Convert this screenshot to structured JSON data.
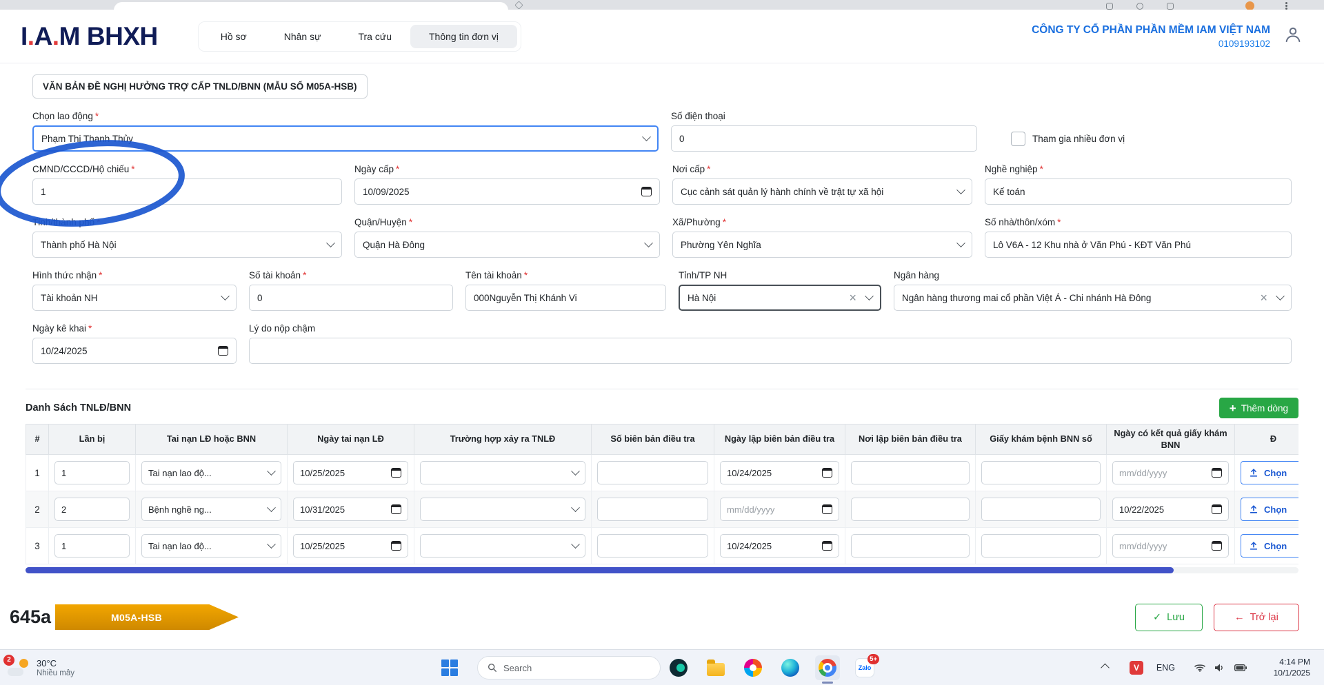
{
  "icons": {
    "check": "✓",
    "arrow_left": "←",
    "plus": "+",
    "clear": "×"
  },
  "header": {
    "logo": {
      "l1": "I",
      "d1": ".",
      "l2": "A",
      "d2": ".",
      "l3": "M",
      "suffix": "BHXH"
    },
    "nav": [
      {
        "label": "Hồ sơ"
      },
      {
        "label": "Nhân sự"
      },
      {
        "label": "Tra cứu"
      },
      {
        "label": "Thông tin đơn vị"
      }
    ],
    "company": "CÔNG TY CỔ PHẦN PHẦN MỀM IAM VIỆT NAM",
    "tax_code": "0109193102"
  },
  "ui": {
    "required_marker": "*"
  },
  "form": {
    "title": "VĂN BẢN ĐỀ NGHỊ HƯỞNG TRỢ CẤP TNLD/BNN (MẪU SỐ M05A-HSB)",
    "fields": {
      "chon_lao_dong": {
        "label": "Chọn lao động",
        "value": "Phạm Thị Thanh Thủy"
      },
      "so_dien_thoai": {
        "label": "Số điện thoại",
        "value": "0"
      },
      "tham_gia_nhieu_don_vi": {
        "label": "Tham gia nhiều đơn vị"
      },
      "cmnd": {
        "label": "CMND/CCCD/Hộ chiếu",
        "value": "1"
      },
      "ngay_cap": {
        "label": "Ngày cấp",
        "value": "10/09/2025"
      },
      "noi_cap": {
        "label": "Nơi cấp",
        "value": "Cục cảnh sát quản lý hành chính về trật tự xã hội"
      },
      "nghe_nghiep": {
        "label": "Nghề nghiệp",
        "value": "Kế toán"
      },
      "tinh_thanh_pho": {
        "label": "Tỉnh/thành phố",
        "value": "Thành phố Hà Nội"
      },
      "quan_huyen": {
        "label": "Quận/Huyện",
        "value": "Quận Hà Đông"
      },
      "xa_phuong": {
        "label": "Xã/Phường",
        "value": "Phường Yên Nghĩa"
      },
      "so_nha": {
        "label": "Số nhà/thôn/xóm",
        "value": "Lô V6A - 12 Khu nhà ở Văn Phú - KĐT Văn Phú"
      },
      "hinh_thuc_nhan": {
        "label": "Hình thức nhận",
        "value": "Tài khoản NH"
      },
      "so_tai_khoan": {
        "label": "Số tài khoản",
        "value": "0"
      },
      "ten_tai_khoan": {
        "label": "Tên tài khoản",
        "value": "000Nguyễn Thị Khánh Vi"
      },
      "tinh_tp_nh": {
        "label": "Tỉnh/TP NH",
        "value": "Hà Nội"
      },
      "ngan_hang": {
        "label": "Ngân hàng",
        "value": "Ngân hàng thương mai cổ phần Việt Á - Chi nhánh Hà Đông"
      },
      "ngay_ke_khai": {
        "label": "Ngày kê khai",
        "value": "10/24/2025"
      },
      "ly_do_nop_cham": {
        "label": "Lý do nộp chậm",
        "value": ""
      }
    }
  },
  "table": {
    "title": "Danh Sách TNLĐ/BNN",
    "add_row_label": "Thêm dòng",
    "choose_file_label": "Chọn",
    "date_placeholder": "mm/dd/yyyy",
    "columns": [
      "#",
      "Lần bị",
      "Tai nạn LĐ hoặc BNN",
      "Ngày tai nạn LĐ",
      "Trường hợp xảy ra TNLĐ",
      "Số biên bản điều tra",
      "Ngày lập biên bản điều tra",
      "Nơi lập biên bản điều tra",
      "Giấy khám bệnh BNN số",
      "Ngày có kết quả giấy khám BNN",
      "Đ"
    ],
    "rows": [
      {
        "stt": "1",
        "lan_bi": "1",
        "loai": "Tai nạn lao độ...",
        "ngay_tai_nan": "10/25/2025",
        "ngay_lap": "10/24/2025",
        "ngay_ket_qua": ""
      },
      {
        "stt": "2",
        "lan_bi": "2",
        "loai": "Bệnh nghề ng...",
        "ngay_tai_nan": "10/31/2025",
        "ngay_lap": "",
        "ngay_ket_qua": "10/22/2025"
      },
      {
        "stt": "3",
        "lan_bi": "1",
        "loai": "Tai nạn lao độ...",
        "ngay_tai_nan": "10/25/2025",
        "ngay_lap": "10/24/2025",
        "ngay_ket_qua": ""
      }
    ]
  },
  "footer": {
    "code": "645a",
    "banner": "M05A-HSB",
    "save_label": "Lưu",
    "back_label": "Trở lại"
  },
  "taskbar": {
    "weather": {
      "badge": "2",
      "temp": "30°C",
      "condition": "Nhiều mây"
    },
    "search_placeholder": "Search",
    "zalo_label": "Zalo",
    "zalo_badge": "5+",
    "tray": {
      "lang": "ENG",
      "time": "4:14 PM",
      "date": "10/1/2025"
    }
  }
}
